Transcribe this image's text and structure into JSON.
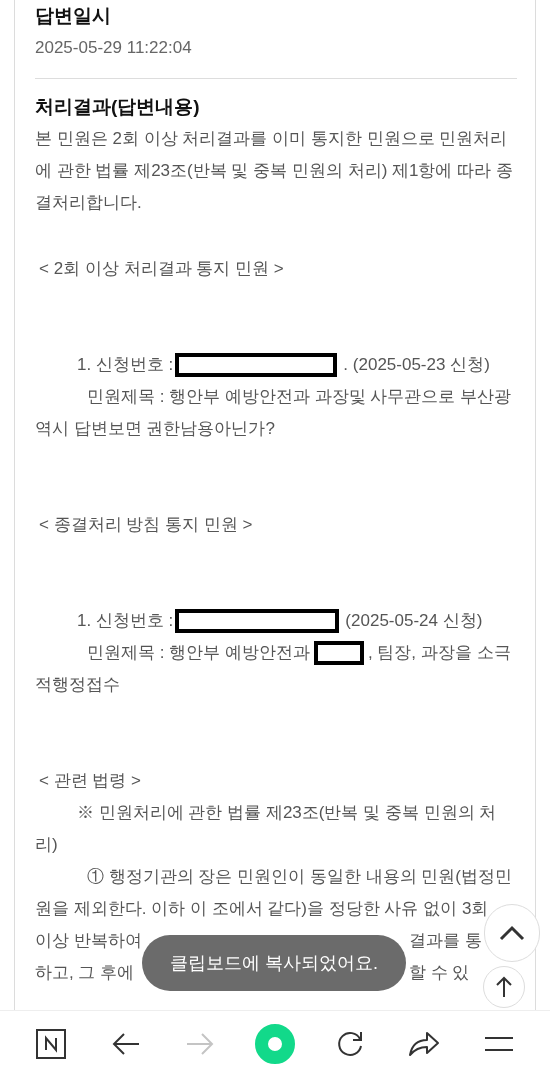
{
  "answer_date": {
    "label": "답변일시",
    "value": "2025-05-29 11:22:04"
  },
  "result": {
    "label": "처리결과(답변내용)",
    "blocks": [
      {
        "kind": "text",
        "text": "본 민원은 2회 이상 처리결과를 이미 통지한 민원으로 민원처리에 관한 법률 제23조(반복 및 중복 민원의 처리) 제1항에 따라 종결처리합니다."
      },
      {
        "kind": "section",
        "text": "< 2회 이상 처리결과 통지 민원 >"
      },
      {
        "kind": "item",
        "number": "1. 신청번호 :",
        "date": ". (2025-05-23 신청)",
        "title_parts": [
          "민원제목 : 행안부 예방안전과 과장및 사무관으로 부산광역시 답변보면  권한남용아닌가?"
        ]
      },
      {
        "kind": "section",
        "text": "< 종결처리 방침 통지 민원 >"
      },
      {
        "kind": "item",
        "number": "1. 신청번호 :",
        "date": "(2025-05-24 신청)",
        "title_parts": [
          "민원제목 : 행안부 예방안전과",
          ", 팀장, 과장을 소극",
          "적행정접수"
        ]
      },
      {
        "kind": "section",
        "text": "< 관련 법령 >"
      },
      {
        "kind": "law",
        "title": "※ 민원처리에 관한 법률 제23조(반복 및 중복 민원의 처리)",
        "clause": "① 행정기관의 장은 민원인이 동일한 내용의 민원(법정민원을 제외한다. 이하 이 조에서 같다)을 정당한 사유 없이 3회",
        "covered_lines": [
          [
            "이상 반복하여",
            "결과를 통"
          ],
          [
            "하고, 그 후에",
            "할 수 있"
          ]
        ]
      }
    ]
  },
  "toast": "클립보드에 복사되었어요.",
  "toolbar": [
    {
      "kind": "home",
      "disabled": false
    },
    {
      "kind": "back",
      "disabled": false
    },
    {
      "kind": "forward",
      "disabled": true
    },
    {
      "kind": "green",
      "disabled": false
    },
    {
      "kind": "reload",
      "disabled": false
    },
    {
      "kind": "share",
      "disabled": false
    },
    {
      "kind": "menu",
      "disabled": false
    }
  ]
}
